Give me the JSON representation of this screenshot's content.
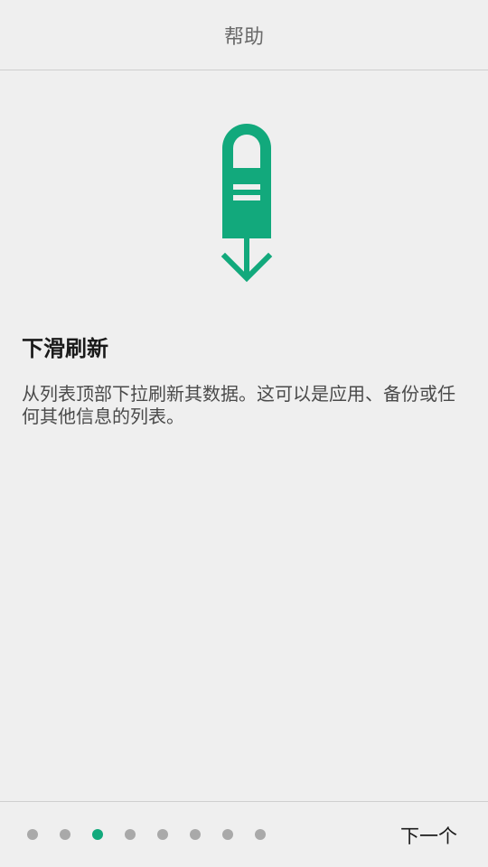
{
  "header": {
    "title": "帮助"
  },
  "tip": {
    "title": "下滑刷新",
    "body": "从列表顶部下拉刷新其数据。这可以是应用、备份或任何其他信息的列表。",
    "illustration_icon": "swipe-down-finger-icon"
  },
  "footer": {
    "page_count": 8,
    "current_page": 3,
    "next_label": "下一个"
  },
  "colors": {
    "accent": "#12a97c",
    "dot_inactive": "#a9a9a9",
    "background": "#efefef"
  }
}
